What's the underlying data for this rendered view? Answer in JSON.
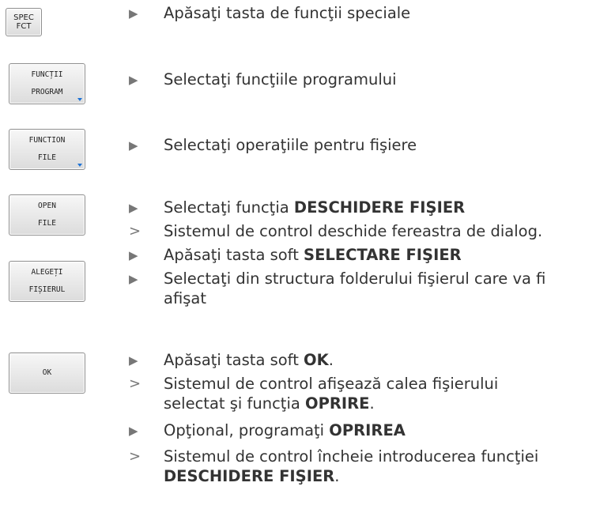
{
  "keys": {
    "spec_fct": [
      "SPEC",
      "FCT"
    ],
    "functii_program": [
      "FUNCȚII",
      "PROGRAM"
    ],
    "function_file": [
      "FUNCTION",
      "FILE"
    ],
    "open_file": [
      "OPEN",
      "FILE"
    ],
    "alegeti_fisierul": [
      "ALEGEȚI",
      "FIȘIERUL"
    ],
    "ok": [
      "OK"
    ]
  },
  "markers": {
    "action": "▶",
    "result": ">"
  },
  "steps": [
    {
      "text": "Apăsaţi tasta de funcţii speciale"
    },
    {
      "text": "Selectaţi funcţiile programului"
    },
    {
      "text": "Selectaţi operaţiile pentru fişiere"
    },
    {
      "text": "Selectaţi funcţia ",
      "bold": "DESCHIDERE FIŞIER"
    },
    {
      "text": "Sistemul de control deschide fereastra de dialog."
    },
    {
      "text": "Apăsaţi tasta soft ",
      "bold": "SELECTARE FIŞIER"
    },
    {
      "text": "Selectaţi din structura folderului fişierul care va fi",
      "cont": "afişat"
    },
    {
      "text": "Apăsaţi tasta soft ",
      "bold": "OK",
      "after": "."
    },
    {
      "text": "Sistemul de control afişează calea fişierului",
      "cont": "selectat şi funcţia ",
      "cont_bold": "OPRIRE",
      "cont_after": "."
    },
    {
      "text": "Opţional, programaţi ",
      "bold": "OPRIREA"
    },
    {
      "text": "Sistemul de control încheie introducerea funcţiei",
      "cont_bold": "DESCHIDERE FIŞIER",
      "cont_after": "."
    }
  ]
}
